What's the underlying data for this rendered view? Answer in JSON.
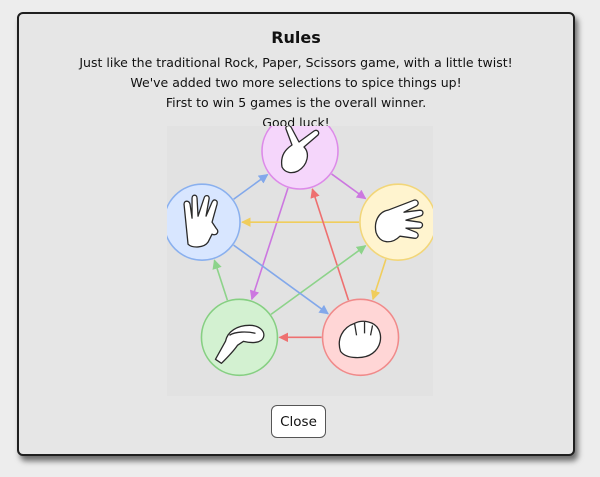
{
  "rules": {
    "title": "Rules",
    "lines": [
      "Just like the traditional Rock, Paper, Scissors game, with a little twist!",
      "We've added two more selections to spice things up!",
      "First to win 5 games is the overall winner.",
      "Good luck!"
    ],
    "close_label": "Close"
  },
  "diagram": {
    "choices": [
      {
        "name": "scissors",
        "icon": "scissors-hand-icon",
        "fill": "#f5d6fb",
        "stroke": "#dd8ae9"
      },
      {
        "name": "paper",
        "icon": "paper-hand-icon",
        "fill": "#fff4cf",
        "stroke": "#f2d679"
      },
      {
        "name": "rock",
        "icon": "rock-fist-icon",
        "fill": "#ffd6d6",
        "stroke": "#f08a8a"
      },
      {
        "name": "lizard",
        "icon": "lizard-hand-icon",
        "fill": "#d3f1d1",
        "stroke": "#86cf82"
      },
      {
        "name": "spock",
        "icon": "spock-hand-icon",
        "fill": "#d8e6ff",
        "stroke": "#8ab0ee"
      }
    ],
    "arrow_colors": {
      "scissors": "#cc77e0",
      "paper": "#f0cd5c",
      "rock": "#ee7070",
      "lizard": "#8dd38a",
      "spock": "#82a8ea"
    }
  }
}
